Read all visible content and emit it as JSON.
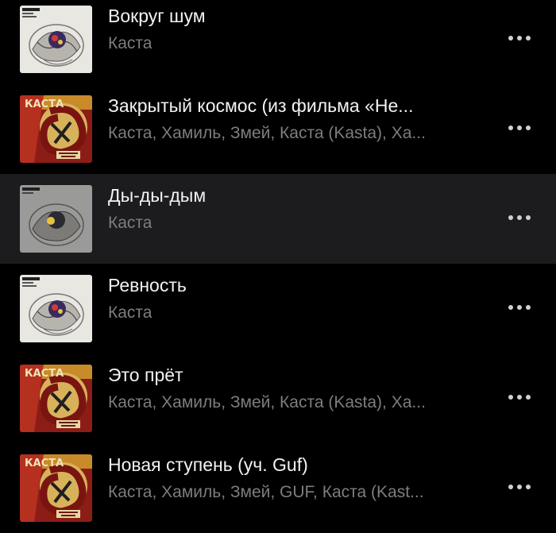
{
  "tracks": [
    {
      "title": "Вокруг шум",
      "artist": "Каста",
      "cover": "white-album-art",
      "active": false
    },
    {
      "title": "Закрытый космос (из фильма «Не...",
      "artist": "Каста, Хамиль, Змей, Каста (Kasta), Ха...",
      "cover": "red-album-art",
      "active": false
    },
    {
      "title": "Ды-ды-дым",
      "artist": "Каста",
      "cover": "white-album-art",
      "active": true
    },
    {
      "title": "Ревность",
      "artist": "Каста",
      "cover": "white-album-art",
      "active": false
    },
    {
      "title": "Это прёт",
      "artist": "Каста, Хамиль, Змей, Каста (Kasta), Ха...",
      "cover": "red-album-art",
      "active": false
    },
    {
      "title": "Новая ступень (уч. Guf)",
      "artist": "Каста, Хамиль, Змей, GUF, Каста (Kast...",
      "cover": "red-album-art",
      "active": false
    }
  ],
  "colors": {
    "background": "#000000",
    "active_row": "#1c1c1e",
    "title": "#f2f2f2",
    "subtitle": "#7d7d80",
    "more_dots": "#d0d0d0"
  }
}
